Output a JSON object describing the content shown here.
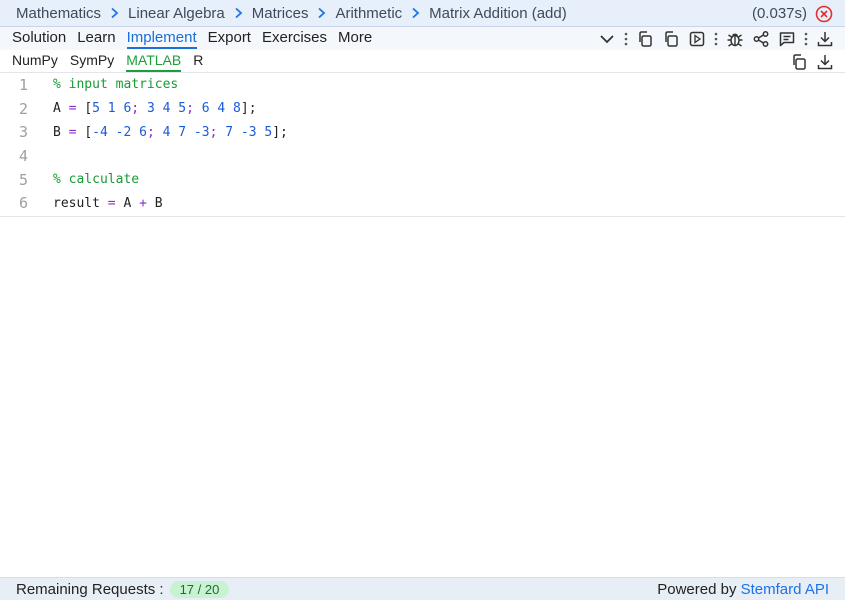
{
  "breadcrumb": {
    "items": [
      "Mathematics",
      "Linear Algebra",
      "Matrices",
      "Arithmetic",
      "Matrix Addition (add)"
    ],
    "timing": "(0.037s)"
  },
  "tabs": [
    "Solution",
    "Learn",
    "Implement",
    "Export",
    "Exercises",
    "More"
  ],
  "active_tab": "Implement",
  "subtabs": [
    "NumPy",
    "SymPy",
    "MATLAB",
    "R"
  ],
  "active_subtab": "MATLAB",
  "code": {
    "line_numbers": [
      "1",
      "2",
      "3",
      "4",
      "5",
      "6"
    ],
    "line1_comment": "% input matrices",
    "line2": {
      "var": "A",
      "eq": "=",
      "open": "[",
      "r1": "5 1 6",
      "s1": ";",
      "r2": "3 4 5",
      "s2": ";",
      "r3": "6 4 8",
      "close": "];"
    },
    "line3": {
      "var": "B",
      "eq": "=",
      "open": "[",
      "r1": "-4 -2 6",
      "s1": ";",
      "r2": "4 7 -3",
      "s2": ";",
      "r3": "7 -3 5",
      "close": "];"
    },
    "line5_comment": "% calculate",
    "line6": {
      "var": "result",
      "eq": "=",
      "a": "A",
      "op": "+",
      "b": "B"
    }
  },
  "footer": {
    "remaining_label": "Remaining Requests :",
    "remaining_value": "17 / 20",
    "powered_label": "Powered by",
    "powered_link": "Stemfard API"
  },
  "colors": {
    "accent": "#1a73e8",
    "matlab_green": "#1e9e3a",
    "close_red": "#e03030"
  },
  "icons": [
    "chevron-right-icon",
    "close-circle-icon",
    "chevron-down-icon",
    "copy-icon",
    "run-icon",
    "bug-icon",
    "share-icon",
    "comment-icon",
    "download-icon"
  ]
}
